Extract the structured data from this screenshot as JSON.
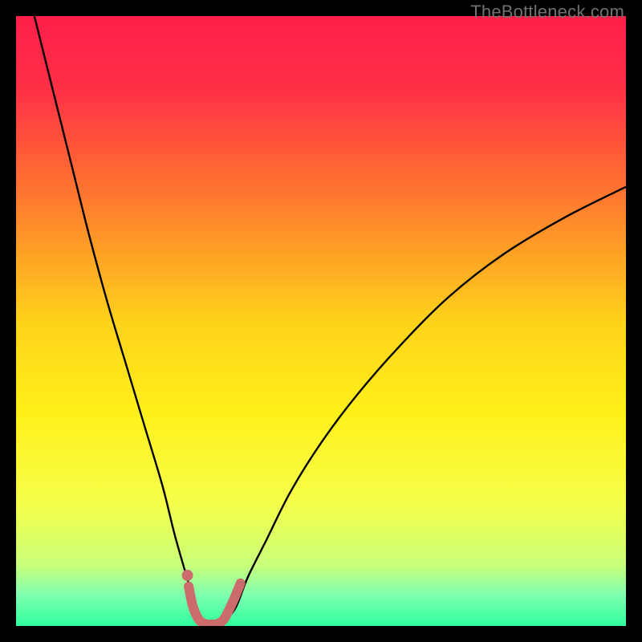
{
  "watermark": "TheBottleneck.com",
  "chart_data": {
    "type": "line",
    "title": "",
    "xlabel": "",
    "ylabel": "",
    "xlim": [
      0,
      100
    ],
    "ylim": [
      0,
      100
    ],
    "grid": false,
    "legend": false,
    "gradient_stops": [
      {
        "offset": 0.0,
        "color": "#ff1f4a"
      },
      {
        "offset": 0.12,
        "color": "#ff3046"
      },
      {
        "offset": 0.3,
        "color": "#ff7a2e"
      },
      {
        "offset": 0.5,
        "color": "#ffd21a"
      },
      {
        "offset": 0.65,
        "color": "#fff01a"
      },
      {
        "offset": 0.8,
        "color": "#f5ff4a"
      },
      {
        "offset": 0.9,
        "color": "#c9ff7a"
      },
      {
        "offset": 0.95,
        "color": "#7dffb0"
      },
      {
        "offset": 1.0,
        "color": "#2fff9f"
      }
    ],
    "series": [
      {
        "name": "bottleneck-curve",
        "stroke": "#000000",
        "stroke_width": 2.4,
        "x": [
          3,
          6,
          9,
          12,
          15,
          18,
          21,
          24,
          26,
          28,
          29.5,
          31,
          32.5,
          34,
          36,
          38,
          41,
          45,
          50,
          56,
          63,
          71,
          80,
          90,
          100
        ],
        "y": [
          100,
          88,
          76,
          64,
          53,
          43,
          33,
          23,
          15,
          8,
          3,
          0.8,
          0.3,
          0.8,
          3,
          8,
          14,
          22,
          30,
          38,
          46,
          54,
          61,
          67,
          72
        ]
      },
      {
        "name": "fit-curve",
        "stroke": "#cc6b6b",
        "stroke_width": 12,
        "linecap": "round",
        "x": [
          28.3,
          29.0,
          30.0,
          31.0,
          32.0,
          33.0,
          34.0,
          35.0,
          36.0,
          36.8
        ],
        "y": [
          6.5,
          3.2,
          1.0,
          0.35,
          0.25,
          0.35,
          1.0,
          2.8,
          5.0,
          7.0
        ]
      },
      {
        "name": "fit-dot",
        "type": "scatter",
        "fill": "#cc6b6b",
        "radius": 7,
        "x": [
          28.1
        ],
        "y": [
          8.3
        ]
      }
    ]
  }
}
